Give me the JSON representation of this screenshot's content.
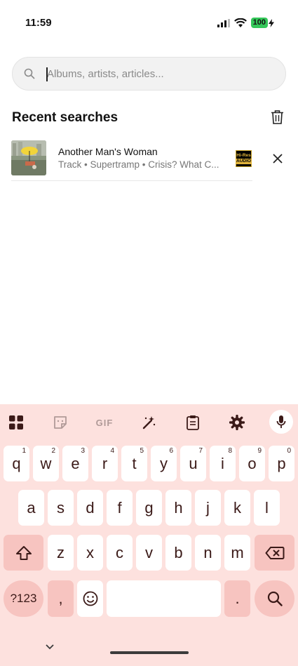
{
  "status": {
    "time": "11:59",
    "battery": "100"
  },
  "search": {
    "placeholder": "Albums, artists, articles...",
    "value": ""
  },
  "recent": {
    "title": "Recent searches",
    "items": [
      {
        "title": "Another Man's Woman",
        "subtitle": "Track • Supertramp • Crisis? What C...",
        "badge_top": "Hi-Res",
        "badge_bottom": "AUDIO"
      }
    ]
  },
  "keyboard": {
    "toolbar": {
      "gif": "GIF"
    },
    "row1": [
      {
        "k": "q",
        "h": "1"
      },
      {
        "k": "w",
        "h": "2"
      },
      {
        "k": "e",
        "h": "3"
      },
      {
        "k": "r",
        "h": "4"
      },
      {
        "k": "t",
        "h": "5"
      },
      {
        "k": "y",
        "h": "6"
      },
      {
        "k": "u",
        "h": "7"
      },
      {
        "k": "i",
        "h": "8"
      },
      {
        "k": "o",
        "h": "9"
      },
      {
        "k": "p",
        "h": "0"
      }
    ],
    "row2": [
      "a",
      "s",
      "d",
      "f",
      "g",
      "h",
      "j",
      "k",
      "l"
    ],
    "row3": [
      "z",
      "x",
      "c",
      "v",
      "b",
      "n",
      "m"
    ],
    "symbols": "?123",
    "comma": ",",
    "period": "."
  }
}
